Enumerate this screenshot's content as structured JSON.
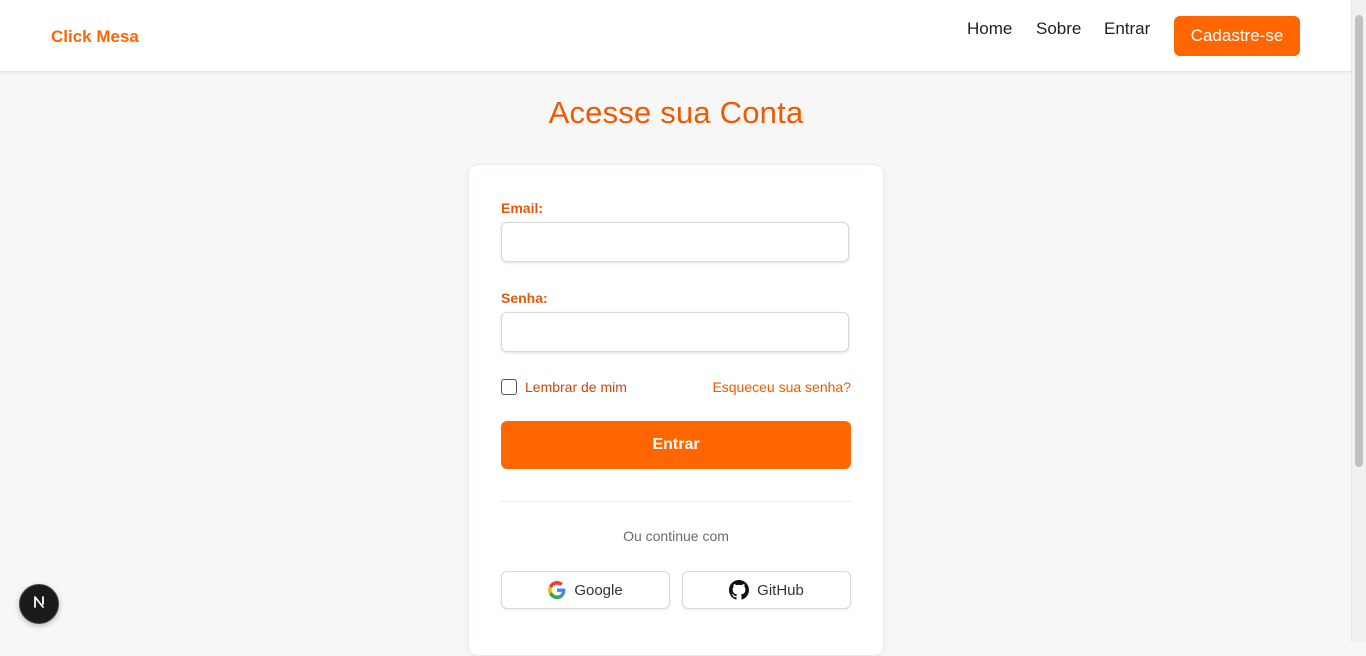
{
  "nav": {
    "brand": "Click Mesa",
    "links": [
      "Home",
      "Sobre",
      "Entrar"
    ],
    "signup_label": "Cadastre-se"
  },
  "main": {
    "title": "Acesse sua Conta"
  },
  "form": {
    "email_label": "Email:",
    "email_value": "",
    "senha_label": "Senha:",
    "senha_value": "",
    "remember_label": "Lembrar de mim",
    "remember_checked": false,
    "forgot_label": "Esqueceu sua senha?",
    "submit_label": "Entrar",
    "continue_text": "Ou continue com",
    "google_label": "Google",
    "github_label": "GitHub"
  },
  "icons": {
    "google": "google-icon",
    "github": "github-icon",
    "dev_badge": "nextjs-icon"
  },
  "colors": {
    "accent": "#ff6600",
    "title": "#ee5a00",
    "background": "#f7f7f7"
  }
}
